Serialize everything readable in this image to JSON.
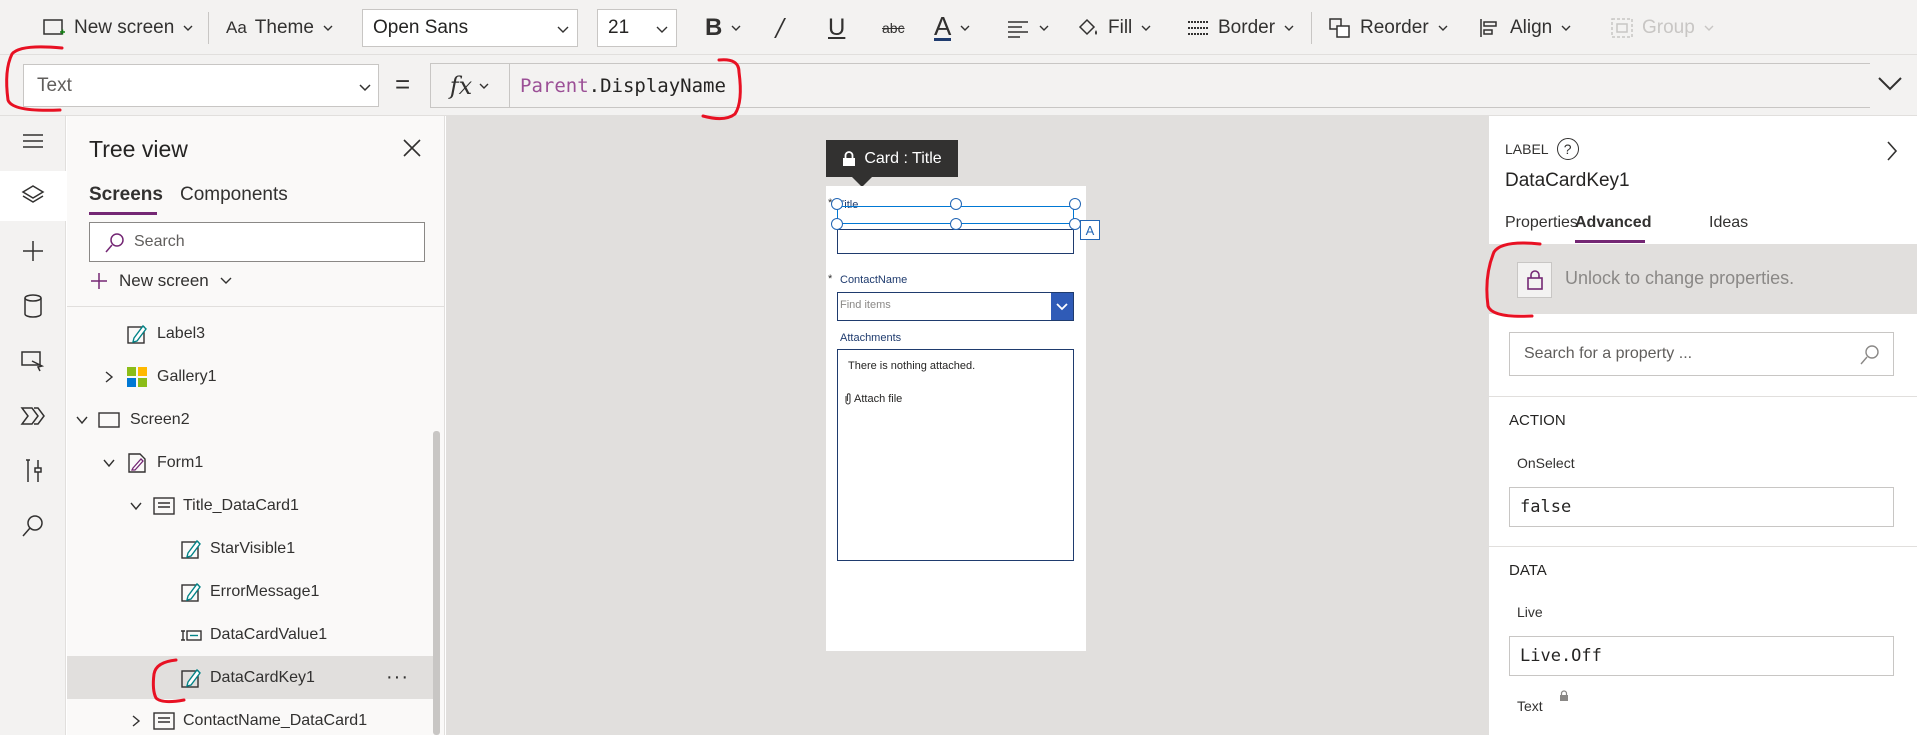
{
  "toolbar": {
    "new_screen": "New screen",
    "theme": "Theme",
    "font": "Open Sans",
    "font_size": "21",
    "fill": "Fill",
    "border": "Border",
    "reorder": "Reorder",
    "align": "Align",
    "group": "Group"
  },
  "formula": {
    "property": "Text",
    "equals": "=",
    "fx": "fx",
    "keyword": "Parent",
    "rest": ".DisplayName"
  },
  "tree": {
    "title": "Tree view",
    "tab_screens": "Screens",
    "tab_components": "Components",
    "search_placeholder": "Search",
    "new_screen": "New screen",
    "nodes": [
      {
        "label": "Label3"
      },
      {
        "label": "Gallery1"
      },
      {
        "label": "Screen2"
      },
      {
        "label": "Form1"
      },
      {
        "label": "Title_DataCard1"
      },
      {
        "label": "StarVisible1"
      },
      {
        "label": "ErrorMessage1"
      },
      {
        "label": "DataCardValue1"
      },
      {
        "label": "DataCardKey1"
      },
      {
        "label": "ContactName_DataCard1"
      }
    ]
  },
  "canvas": {
    "tooltip": "Card : Title",
    "title_label": "Title",
    "star": "*",
    "contact_label": "ContactName",
    "find_items": "Find items",
    "attachments_label": "Attachments",
    "attach_empty": "There is nothing attached.",
    "attach_file": "Attach file",
    "badge": "A"
  },
  "props": {
    "type": "LABEL",
    "help": "?",
    "name": "DataCardKey1",
    "tab_properties": "Properties",
    "tab_advanced": "Advanced",
    "tab_ideas": "Ideas",
    "lock_message": "Unlock to change properties.",
    "search_placeholder": "Search for a property ...",
    "section_action": "ACTION",
    "onselect_label": "OnSelect",
    "onselect_value": "false",
    "section_data": "DATA",
    "live_label": "Live",
    "live_value": "Live.Off",
    "text_label": "Text"
  },
  "colors": {
    "accent": "#742774",
    "selection": "#2266b5",
    "annotation": "#e81123"
  }
}
